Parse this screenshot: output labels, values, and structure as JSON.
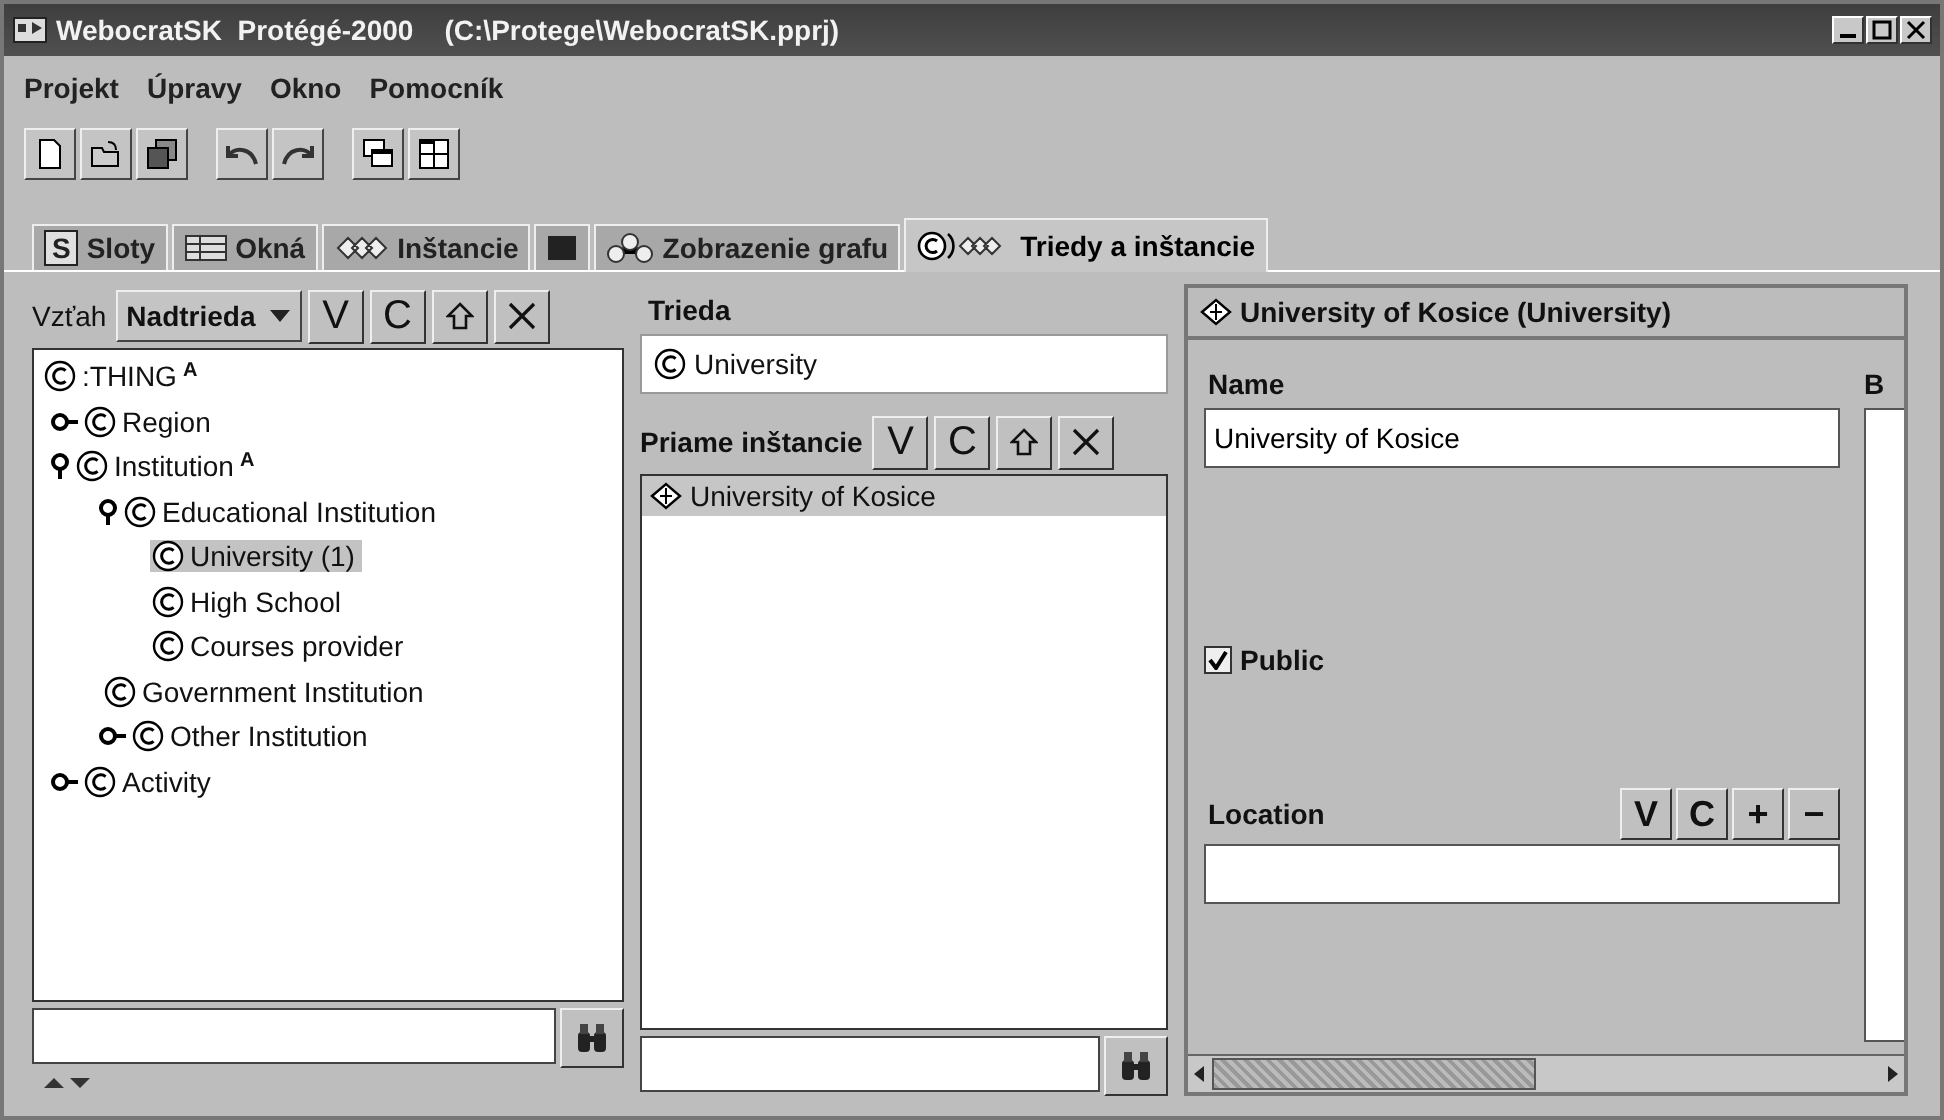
{
  "window": {
    "title": "WebocratSK  Protégé-2000    (C:\\Protege\\WebocratSK.pprj)"
  },
  "menu": [
    "Projekt",
    "Úpravy",
    "Okno",
    "Pomocník"
  ],
  "toolbar": [
    {
      "kind": "new"
    },
    {
      "kind": "open"
    },
    {
      "kind": "save"
    },
    {
      "kind": "sep"
    },
    {
      "kind": "undo"
    },
    {
      "kind": "redo"
    },
    {
      "kind": "sep"
    },
    {
      "kind": "cascade"
    },
    {
      "kind": "tile"
    }
  ],
  "tabs": [
    {
      "kind": "slots",
      "badge": "S",
      "label": "Sloty",
      "selected": false
    },
    {
      "kind": "forms",
      "label": "Okná",
      "selected": false
    },
    {
      "kind": "instances",
      "label": "Inštancie",
      "selected": false
    },
    {
      "kind": "blank",
      "selected": false
    },
    {
      "kind": "graph",
      "label": "Zobrazenie grafu",
      "selected": false
    },
    {
      "kind": "classes",
      "label": "Triedy a inštancie",
      "selected": true
    }
  ],
  "class_panel": {
    "relation_label": "Vzťah",
    "relation_value": "Nadtrieda",
    "buttons": [
      {
        "kind": "text",
        "label": "V"
      },
      {
        "kind": "text",
        "label": "C"
      },
      {
        "kind": "up"
      },
      {
        "kind": "delete"
      }
    ],
    "tree": [
      {
        "label": ":THING",
        "flag": "A",
        "selected": false,
        "children": [
          {
            "label": "Region",
            "expandable": true,
            "expanded": false,
            "selected": false
          },
          {
            "label": "Institution",
            "flag": "A",
            "expandable": true,
            "expanded": true,
            "selected": false,
            "children": [
              {
                "label": "Educational Institution",
                "expandable": true,
                "expanded": true,
                "selected": false,
                "children": [
                  {
                    "label": "University  (1)",
                    "expandable": false,
                    "selected": true
                  },
                  {
                    "label": "High School",
                    "expandable": false,
                    "selected": false
                  },
                  {
                    "label": "Courses provider",
                    "expandable": false,
                    "selected": false
                  }
                ]
              },
              {
                "label": "Government Institution",
                "expandable": false,
                "selected": false
              },
              {
                "label": "Other Institution",
                "expandable": true,
                "expanded": false,
                "selected": false
              }
            ]
          },
          {
            "label": "Activity",
            "expandable": true,
            "expanded": false,
            "selected": false
          }
        ]
      }
    ]
  },
  "instance_panel": {
    "class_label": "Trieda",
    "class_value": "University",
    "instances_label": "Priame inštancie",
    "buttons": [
      {
        "kind": "text",
        "label": "V"
      },
      {
        "kind": "text",
        "label": "C"
      },
      {
        "kind": "up"
      },
      {
        "kind": "delete"
      }
    ],
    "instances": [
      {
        "label": "University of Kosice",
        "selected": true
      }
    ]
  },
  "form": {
    "title": "University of Kosice (University)",
    "name_label": "Name",
    "name_value": "University of Kosice",
    "side_label": "B",
    "public": {
      "label": "Public",
      "checked": true
    },
    "location_label": "Location",
    "location_buttons": [
      {
        "kind": "text",
        "label": "V"
      },
      {
        "kind": "text",
        "label": "C"
      },
      {
        "kind": "text",
        "label": "+"
      },
      {
        "kind": "text",
        "label": "−"
      }
    ]
  }
}
